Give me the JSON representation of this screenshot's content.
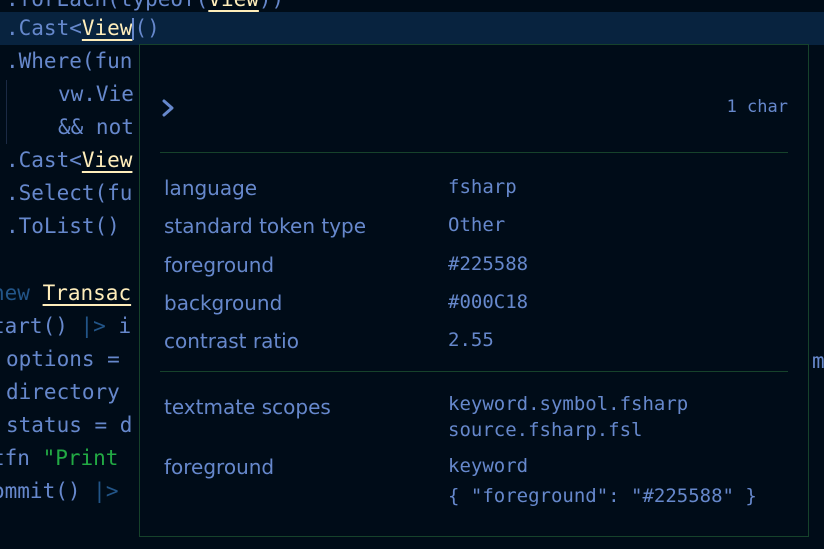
{
  "editor": {
    "lines": [
      {
        "text_a": ".forEach(typeof(",
        "text_b": "View",
        "text_c": "))"
      },
      {
        "text_a": ".Cast<",
        "text_b": "View",
        "text_c": "()"
      },
      {
        "text_a": ".Where(fun"
      },
      {
        "text_a": "vw.Vie"
      },
      {
        "text_a": "&& not"
      },
      {
        "text_a": ".Cast<",
        "text_b": "View"
      },
      {
        "text_a": ".Select(fu"
      },
      {
        "text_a": ".ToList()"
      },
      {
        "text_a": "new",
        "text_b": "Transac"
      },
      {
        "text_a": "tart()",
        "text_b": "|>",
        "text_c": "i"
      },
      {
        "text_a": "options ="
      },
      {
        "text_a": "directory"
      },
      {
        "text_a": "status = d"
      },
      {
        "text_a": "tfn",
        "text_b": "\"Print"
      },
      {
        "text_a": "ommit()",
        "text_b": "|>"
      }
    ],
    "right_fragment": "m"
  },
  "hover": {
    "char_count": "1 char",
    "rows": [
      {
        "label": "language",
        "value": "fsharp"
      },
      {
        "label": "standard token type",
        "value": "Other"
      },
      {
        "label": "foreground",
        "value": "#225588"
      },
      {
        "label": "background",
        "value": "#000C18"
      },
      {
        "label": "contrast ratio",
        "value": "2.55"
      }
    ],
    "scopes_label": "textmate scopes",
    "scopes": [
      "keyword.symbol.fsharp",
      "source.fsharp.fsl"
    ],
    "theme_label": "foreground",
    "theme_value_1": "keyword",
    "theme_value_2": "{ \"foreground\": \"#225588\" }"
  },
  "colors": {
    "background": "#000C18",
    "text": "#6688CC",
    "token_foreground": "#225588",
    "type_name": "#FFEEBB",
    "string": "#22AA44",
    "widget_border": "#16422B",
    "current_line": "#08233F"
  },
  "icons": {
    "expand": "chevron-right-icon"
  }
}
